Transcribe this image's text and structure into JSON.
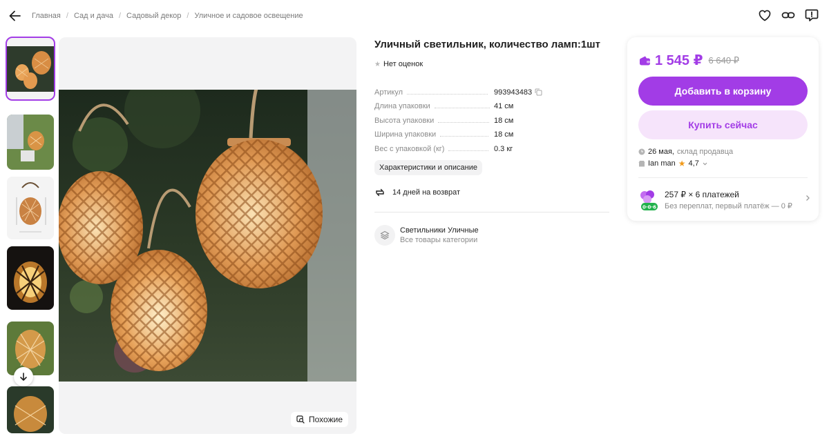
{
  "breadcrumb": [
    "Главная",
    "Сад и дача",
    "Садовый декор",
    "Уличное и садовое освещение"
  ],
  "icons": {
    "back": "arrow-left-icon",
    "favorite": "heart-icon",
    "share": "link-icon",
    "report": "report-icon",
    "similar": "similar-search-icon",
    "copy": "copy-icon",
    "return": "return-arrows-icon",
    "category": "layers-icon",
    "wallet": "wallet-icon",
    "scroll_down": "arrow-down-icon"
  },
  "product": {
    "title": "Уличный светильник, количество ламп:1шт",
    "rating_text": "Нет оценок",
    "specs": [
      {
        "key": "Артикул",
        "value": "993943483"
      },
      {
        "key": "Длина упаковки",
        "value": "41 см"
      },
      {
        "key": "Высота упаковки",
        "value": "18 см"
      },
      {
        "key": "Ширина упаковки",
        "value": "18 см"
      },
      {
        "key": "Вес с упаковкой (кг)",
        "value": "0.3 кг"
      }
    ],
    "chars_button": "Характеристики и описание",
    "return_text": "14 дней на возврат",
    "category_name": "Светильники Уличные",
    "category_sub": "Все товары категории"
  },
  "gallery": {
    "similar_label": "Похожие"
  },
  "buy": {
    "price": "1 545 ₽",
    "old_price": "6 640 ₽",
    "add_to_cart": "Добавить в корзину",
    "buy_now": "Купить сейчас",
    "delivery_date": "26 мая,",
    "delivery_source": "склад продавца",
    "seller_name": "Ian man",
    "seller_rating": "4,7",
    "installment_main": "257 ₽ × 6 платежей",
    "installment_sub": "Без переплат, первый платёж — 0 ₽",
    "installment_badge": "0·0·6"
  },
  "colors": {
    "accent": "#a23ce6",
    "accent_light": "#f6e4fb",
    "star": "#f19a1a",
    "badge_green": "#22b14c"
  }
}
